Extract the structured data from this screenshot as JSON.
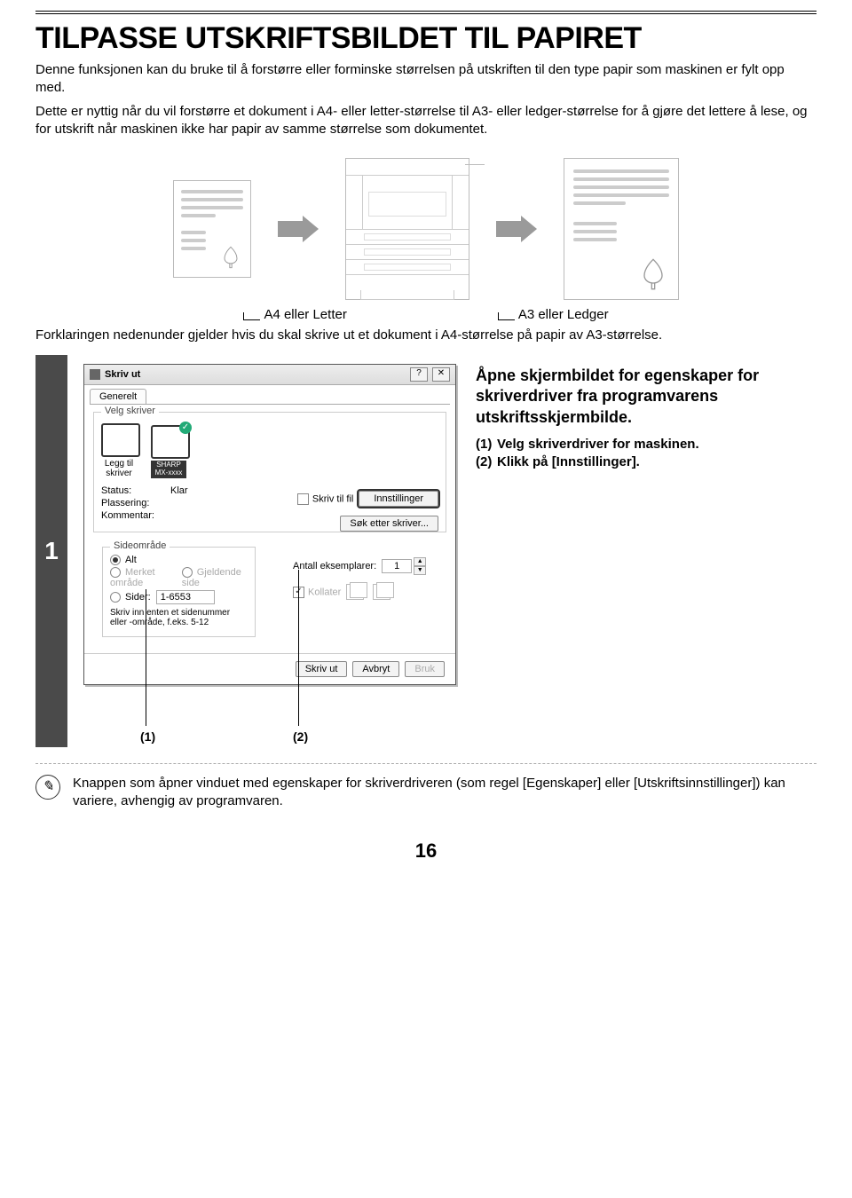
{
  "title": "TILPASSE UTSKRIFTSBILDET TIL PAPIRET",
  "intro_p1": "Denne funksjonen kan du bruke til å forstørre eller forminske størrelsen på utskriften til den type papir som maskinen er fylt opp med.",
  "intro_p2": "Dette er nyttig når du vil forstørre et dokument i A4- eller letter-størrelse til A3- eller ledger-størrelse for å gjøre det lettere å lese, og for utskrift når maskinen ikke har papir av samme størrelse som dokumentet.",
  "diagram": {
    "caption_left": "A4 eller Letter",
    "caption_right": "A3 eller Ledger"
  },
  "sub": "Forklaringen nedenunder gjelder hvis du skal skrive ut et dokument i A4-størrelse på papir av A3-størrelse.",
  "step": {
    "num": "1",
    "callout_1": "(1)",
    "callout_2": "(2)",
    "rhs_heading": "Åpne skjermbildet for egenskaper for skriverdriver fra programvarens utskriftsskjermbilde.",
    "rhs_item1": "Velg skriverdriver for maskinen.",
    "rhs_item2": "Klikk på [Innstillinger].",
    "rhs_n1": "(1)",
    "rhs_n2": "(2)"
  },
  "dialog": {
    "title": "Skriv ut",
    "tab": "Generelt",
    "group_printer": "Velg skriver",
    "add_printer": "Legg til skriver",
    "sel_name": "SHARP MX-xxxx",
    "status_k": "Status:",
    "status_v": "Klar",
    "location_k": "Plassering:",
    "comment_k": "Kommentar:",
    "print_to_file": "Skriv til fil",
    "btn_settings": "Innstillinger",
    "btn_find": "Søk etter skriver...",
    "group_range": "Sideområde",
    "r_all": "Alt",
    "r_sel": "Merket område",
    "r_cur": "Gjeldende side",
    "r_pages": "Sider:",
    "r_pages_val": "1-6553",
    "r_note": "Skriv inn enten et sidenummer eller -område, f.eks. 5-12",
    "copies_label": "Antall eksemplarer:",
    "copies_val": "1",
    "collate": "Kollater",
    "foot_print": "Skriv ut",
    "foot_cancel": "Avbryt",
    "foot_apply": "Bruk"
  },
  "note": "Knappen som åpner vinduet med egenskaper for skriverdriveren (som regel [Egenskaper] eller [Utskriftsinnstillinger]) kan variere, avhengig av programvaren.",
  "page_number": "16"
}
